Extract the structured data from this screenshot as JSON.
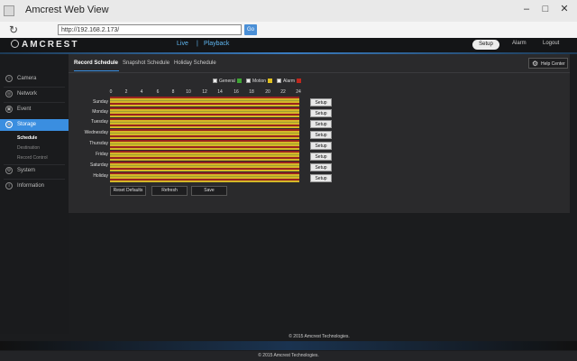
{
  "browser": {
    "window_title": "Amcrest Web View",
    "url": "http://192.168.2.173/",
    "go_label": "Go"
  },
  "header": {
    "logo": "AMCREST",
    "nav_live": "Live",
    "nav_separator": "|",
    "nav_playback": "Playback",
    "setup": "Setup",
    "alarm": "Alarm",
    "logout": "Logout"
  },
  "sidebar": {
    "items": [
      {
        "label": "Camera"
      },
      {
        "label": "Network"
      },
      {
        "label": "Event"
      },
      {
        "label": "Storage"
      },
      {
        "label": "System"
      },
      {
        "label": "Information"
      }
    ],
    "storage_sub": [
      "Schedule",
      "Destination",
      "Record Control"
    ]
  },
  "tabs": [
    "Record Schedule",
    "Snapshot Schedule",
    "Holiday Schedule"
  ],
  "help_center": "Help Center",
  "legend": [
    {
      "label": "General",
      "color": "#3fa535"
    },
    {
      "label": "Motion",
      "color": "#e0c020"
    },
    {
      "label": "Alarm",
      "color": "#c0281e"
    }
  ],
  "hours": [
    "0",
    "2",
    "4",
    "6",
    "8",
    "10",
    "12",
    "14",
    "16",
    "18",
    "20",
    "22",
    "24"
  ],
  "days": [
    "Sunday",
    "Monday",
    "Tuesday",
    "Wednesday",
    "Thursday",
    "Friday",
    "Saturday",
    "Holiday"
  ],
  "setup_button": "Setup",
  "buttons": {
    "reset_defaults": "Reset Defaults",
    "refresh": "Refresh",
    "save": "Save"
  },
  "copyright": "© 2015 Amcrest Technologies.",
  "colors": {
    "accent": "#3a8ee0",
    "panel": "#2a2a2c",
    "background": "#1b1c1e"
  }
}
